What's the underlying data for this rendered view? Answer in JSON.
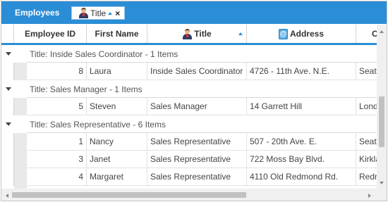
{
  "group_panel": {
    "title": "Employees",
    "chip_label": "Title",
    "chip_close": "×"
  },
  "columns": [
    "Employee ID",
    "First Name",
    "Title",
    "Address",
    "C"
  ],
  "groups": [
    {
      "label": "Title: Inside Sales Coordinator - 1 Items",
      "rows": [
        {
          "id": "8",
          "first_name": "Laura",
          "title": "Inside Sales Coordinator",
          "address": "4726 - 11th Ave. N.E.",
          "city": "Seattle"
        }
      ]
    },
    {
      "label": "Title: Sales Manager - 1 Items",
      "rows": [
        {
          "id": "5",
          "first_name": "Steven",
          "title": "Sales Manager",
          "address": "14 Garrett Hill",
          "city": "London"
        }
      ]
    },
    {
      "label": "Title: Sales Representative - 6 Items",
      "rows": [
        {
          "id": "1",
          "first_name": "Nancy",
          "title": "Sales Representative",
          "address": "507 - 20th Ave. E.",
          "city": "Seattle"
        },
        {
          "id": "3",
          "first_name": "Janet",
          "title": "Sales Representative",
          "address": "722 Moss Bay Blvd.",
          "city": "Kirkland"
        },
        {
          "id": "4",
          "first_name": "Margaret",
          "title": "Sales Representative",
          "address": "4110 Old Redmond Rd.",
          "city": "Redmond"
        }
      ]
    }
  ],
  "icons": {
    "title_column": "person-icon",
    "address_column": "address-icon",
    "sort": "sort-ascending-icon"
  },
  "colors": {
    "accent": "#2b8dd6",
    "indent": "#e9e9e9",
    "scrollbar_thumb": "#c1c1c1"
  }
}
